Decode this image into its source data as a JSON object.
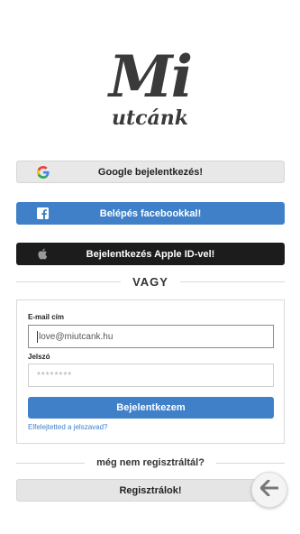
{
  "logo": {
    "main": "Mi",
    "sub": "utcánk"
  },
  "social": {
    "google_label": "Google bejelentkezés!",
    "facebook_label": "Belépés facebookkal!",
    "apple_label": "Bejelentkezés Apple ID-vel!"
  },
  "divider_or": "VAGY",
  "login_form": {
    "email_label": "E-mail cím",
    "email_value": "love@miutcank.hu",
    "password_label": "Jelszó",
    "password_mask": "********",
    "submit_label": "Bejelentkezem",
    "forgot_link": "Elfelejtetted a jelszavad?"
  },
  "register": {
    "prompt": "még nem regisztráltál?",
    "button_label": "Regisztrálok!"
  },
  "icons": {
    "google": "google-icon",
    "facebook": "facebook-icon",
    "apple": "apple-icon",
    "back": "back-arrow-icon"
  },
  "colors": {
    "brand_blue": "#3f80c8",
    "apple_black": "#1c1c1c",
    "light_button": "#e8e8e8"
  }
}
